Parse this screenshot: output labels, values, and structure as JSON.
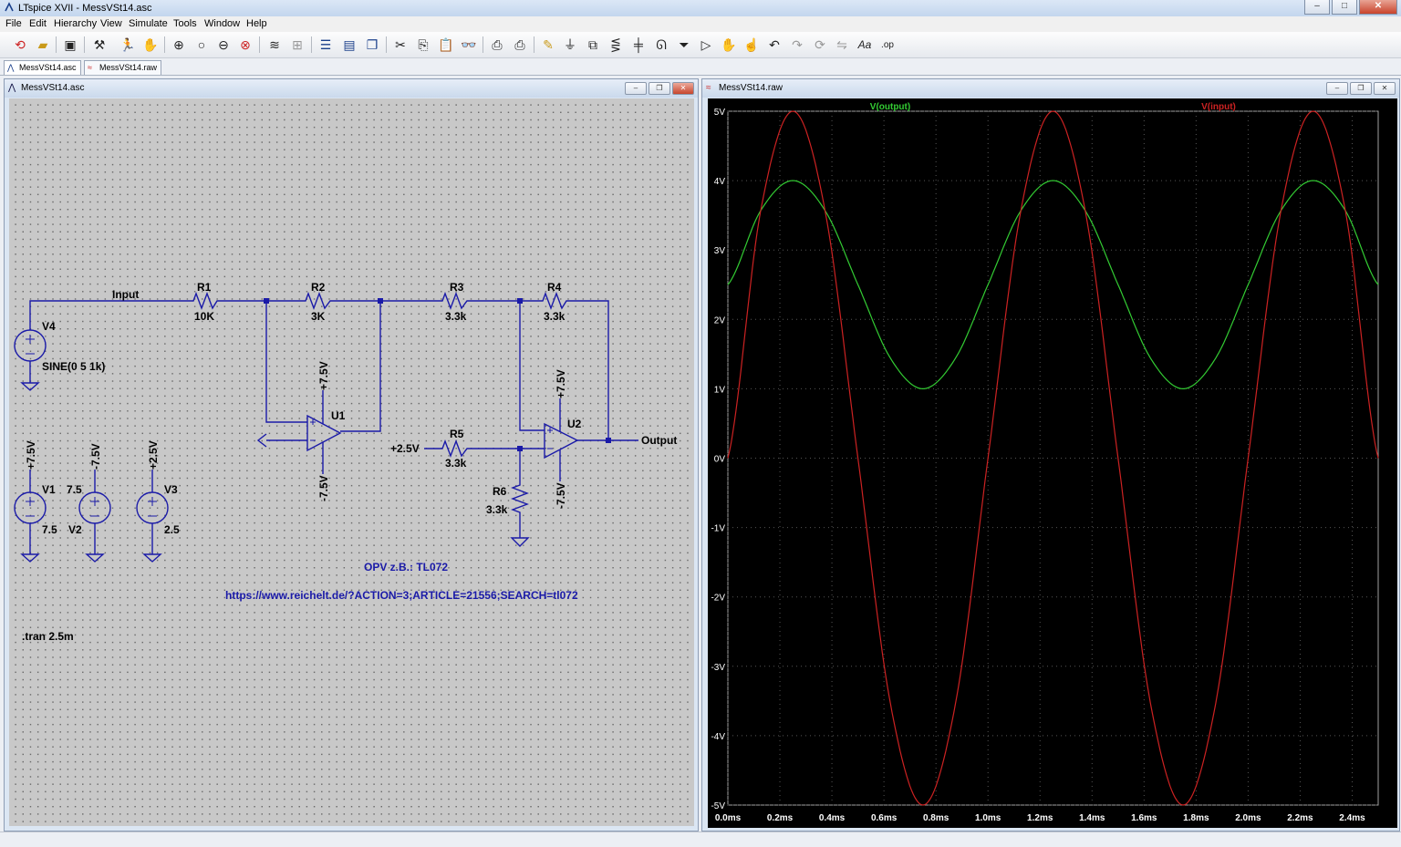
{
  "window": {
    "title": "LTspice XVII - MessVSt14.asc"
  },
  "menu": [
    "File",
    "Edit",
    "Hierarchy",
    "View",
    "Simulate",
    "Tools",
    "Window",
    "Help"
  ],
  "toolbar_icons": [
    "open-new-schematic-icon",
    "open-file-icon",
    "save-icon",
    "control-panel-icon",
    "run-icon",
    "halt-icon",
    "zoom-in-icon",
    "zoom-pan-icon",
    "zoom-out-icon",
    "zoom-fit-icon",
    "autorange-icon",
    "grid-icon",
    "tile-horizontal-icon",
    "tile-vertical-icon",
    "cascade-icon",
    "cut-icon",
    "copy-icon",
    "paste-icon",
    "find-icon",
    "print-setup-icon",
    "print-icon",
    "draw-wire-icon",
    "ground-icon",
    "label-net-icon",
    "resistor-icon",
    "capacitor-icon",
    "inductor-icon",
    "diode-icon",
    "component-icon",
    "move-icon",
    "drag-icon",
    "undo-icon",
    "redo-icon",
    "rotate-icon",
    "mirror-icon",
    "text-icon",
    "spice-directive-icon"
  ],
  "tabs": [
    {
      "label": "MessVSt14.asc",
      "icon": "schematic-icon"
    },
    {
      "label": "MessVSt14.raw",
      "icon": "waveform-icon"
    }
  ],
  "schematic_window": {
    "title": "MessVSt14.asc"
  },
  "plot_window": {
    "title": "MessVSt14.raw"
  },
  "schematic": {
    "net_labels": {
      "input": "Input",
      "output": "Output"
    },
    "components": {
      "r1": {
        "name": "R1",
        "value": "10K"
      },
      "r2": {
        "name": "R2",
        "value": "3K"
      },
      "r3": {
        "name": "R3",
        "value": "3.3k"
      },
      "r4": {
        "name": "R4",
        "value": "3.3k"
      },
      "r5": {
        "name": "R5",
        "value": "3.3k"
      },
      "r6": {
        "name": "R6",
        "value": "3.3k"
      },
      "u1": {
        "name": "U1"
      },
      "u2": {
        "name": "U2"
      },
      "v1": {
        "name": "V1",
        "value": "7.5"
      },
      "v2": {
        "name": "V2",
        "value": "7.5"
      },
      "v3": {
        "name": "V3",
        "value": "2.5"
      },
      "v4": {
        "name": "V4",
        "value": "SINE(0 5 1k)"
      }
    },
    "supply_labels": {
      "pos75": "+7.5V",
      "neg75": "-7.5V",
      "pos25": "+2.5V"
    },
    "comment": "OPV z.B.: TL072",
    "link": "https://www.reichelt.de/?ACTION=3;ARTICLE=21556;SEARCH=tl072",
    "directive": ".tran 2.5m"
  },
  "chart_data": {
    "type": "line",
    "xlabel": "",
    "ylabel": "",
    "xlim": [
      0,
      2.5
    ],
    "ylim": [
      -5,
      5
    ],
    "x_ticks": [
      "0.0ms",
      "0.2ms",
      "0.4ms",
      "0.6ms",
      "0.8ms",
      "1.0ms",
      "1.2ms",
      "1.4ms",
      "1.6ms",
      "1.8ms",
      "2.0ms",
      "2.2ms",
      "2.4ms"
    ],
    "x_tick_values": [
      0,
      0.2,
      0.4,
      0.6,
      0.8,
      1.0,
      1.2,
      1.4,
      1.6,
      1.8,
      2.0,
      2.2,
      2.4
    ],
    "y_ticks": [
      "5V",
      "4V",
      "3V",
      "2V",
      "1V",
      "0V",
      "-1V",
      "-2V",
      "-3V",
      "-4V",
      "-5V"
    ],
    "y_tick_values": [
      5,
      4,
      3,
      2,
      1,
      0,
      -1,
      -2,
      -3,
      -4,
      -5
    ],
    "grid": true,
    "series": [
      {
        "name": "V(output)",
        "color": "#33cc33",
        "x": [
          0,
          0.125,
          0.25,
          0.375,
          0.5,
          0.625,
          0.75,
          0.875,
          1.0,
          1.125,
          1.25,
          1.375,
          1.5,
          1.625,
          1.75,
          1.875,
          2.0,
          2.125,
          2.25,
          2.375,
          2.5
        ],
        "values": [
          2.5,
          3.56,
          4.0,
          3.56,
          2.5,
          1.44,
          1.0,
          1.44,
          2.5,
          3.56,
          4.0,
          3.56,
          2.5,
          1.44,
          1.0,
          1.44,
          2.5,
          3.56,
          4.0,
          3.56,
          2.5
        ]
      },
      {
        "name": "V(input)",
        "color": "#cc2222",
        "x": [
          0,
          0.125,
          0.25,
          0.375,
          0.5,
          0.625,
          0.75,
          0.875,
          1.0,
          1.125,
          1.25,
          1.375,
          1.5,
          1.625,
          1.75,
          1.875,
          2.0,
          2.125,
          2.25,
          2.375,
          2.5
        ],
        "values": [
          0,
          3.54,
          5.0,
          3.54,
          0,
          -3.54,
          -5.0,
          -3.54,
          0,
          3.54,
          5.0,
          3.54,
          0,
          -3.54,
          -5.0,
          -3.54,
          0,
          3.54,
          5.0,
          3.54,
          0
        ]
      }
    ],
    "background": "#000000",
    "grid_color": "#555555",
    "axis_color": "#a0a0a0"
  }
}
